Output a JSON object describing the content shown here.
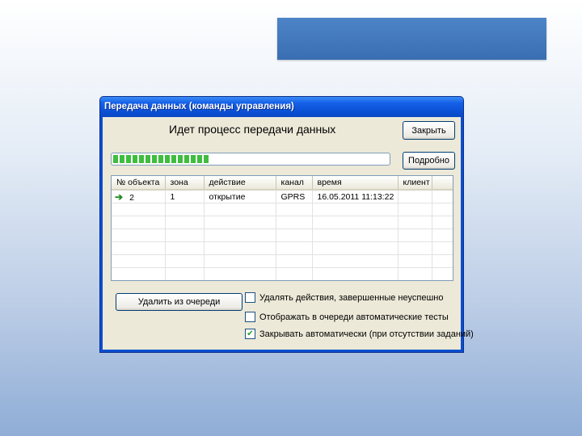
{
  "window": {
    "title": "Передача данных (команды управления)"
  },
  "status_text": "Идет процесс передачи данных",
  "buttons": {
    "close": "Закрыть",
    "details": "Подробно",
    "remove_from_queue": "Удалить из очереди"
  },
  "progress": {
    "percent": 35,
    "color": "#3fbd3f"
  },
  "table": {
    "columns": [
      "№ объекта",
      "зона",
      "действие",
      "канал",
      "время",
      "клиент"
    ],
    "rows": [
      {
        "object": "2",
        "zone": "1",
        "action": "открытие",
        "channel": "GPRS",
        "time": "16.05.2011 11:13:22",
        "client": ""
      }
    ]
  },
  "options": [
    {
      "label": "Удалять действия, завершенные неуспешно",
      "checked": false
    },
    {
      "label": "Отображать в очереди автоматические тесты",
      "checked": false
    },
    {
      "label": "Закрывать автоматически (при отсутствии заданий)",
      "checked": true
    }
  ],
  "icons": {
    "row_status": "arrow-right-icon"
  }
}
